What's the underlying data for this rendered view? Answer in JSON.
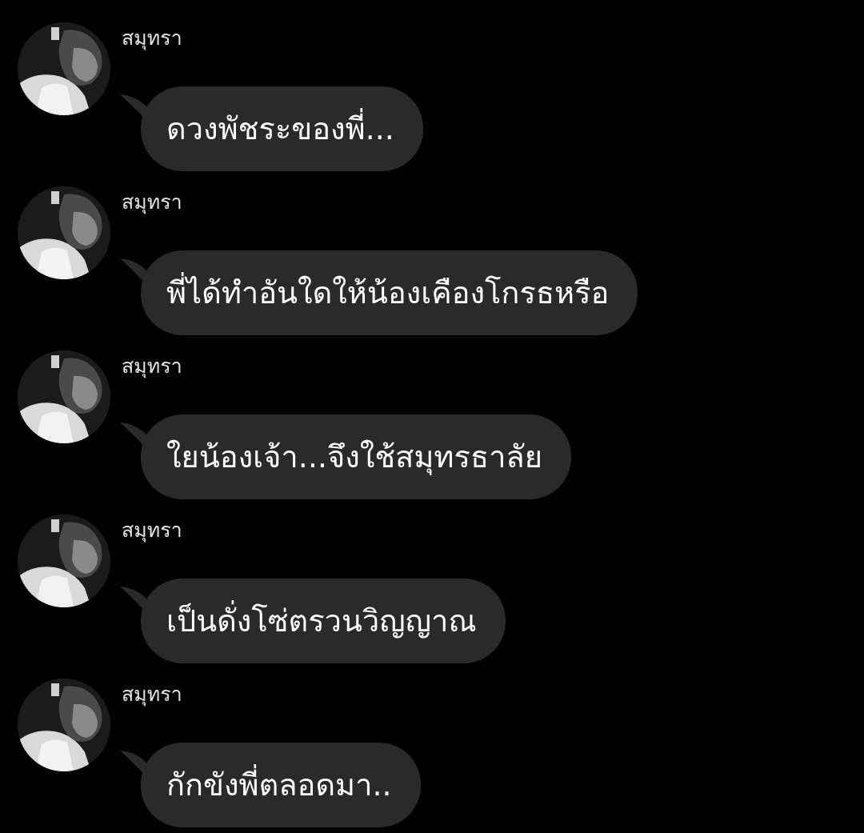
{
  "chat": {
    "messages": [
      {
        "sender": "สมุทรา",
        "text": "ดวงพัชระของพี่...",
        "avatar_icon": "profile-photo"
      },
      {
        "sender": "สมุทรา",
        "text": "พี่ได้ทำอันใดให้น้องเคืองโกรธหรือ",
        "avatar_icon": "profile-photo"
      },
      {
        "sender": "สมุทรา",
        "text": "ใยน้องเจ้า...จึงใช้สมุทรธาลัย",
        "avatar_icon": "profile-photo"
      },
      {
        "sender": "สมุทรา",
        "text": "เป็นดั่งโซ่ตรวนวิญญาณ",
        "avatar_icon": "profile-photo"
      },
      {
        "sender": "สมุทรา",
        "text": "กักขังพี่ตลอดมา..",
        "avatar_icon": "profile-photo"
      }
    ]
  },
  "colors": {
    "background": "#000000",
    "bubble": "#2a2a2a",
    "text": "#ffffff",
    "sender_text": "#e6e6e6"
  }
}
